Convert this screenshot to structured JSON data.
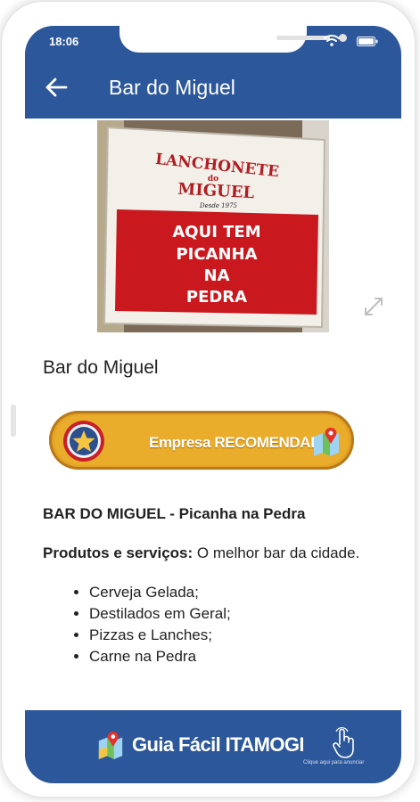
{
  "status_bar": {
    "time": "18:06"
  },
  "app_bar": {
    "title": "Bar do Miguel"
  },
  "photo": {
    "sign_top_line1": "LANCHONETE",
    "sign_top_line2": "do",
    "sign_top_line3": "MIGUEL",
    "sign_since": "Desde 1975",
    "sign_red_line1": "AQUI TEM",
    "sign_red_line2": "PICANHA",
    "sign_red_line3": "NA",
    "sign_red_line4": "PEDRA"
  },
  "business": {
    "name": "Bar do Miguel"
  },
  "badge": {
    "label": "Empresa RECOMENDADA"
  },
  "content": {
    "headline": "BAR DO MIGUEL - Picanha na Pedra",
    "desc_label": "Produtos e serviços:",
    "desc_text": " O melhor bar da cidade.",
    "items": [
      "Cerveja Gelada;",
      "Destilados em Geral;",
      "Pizzas e Lanches;",
      "Carne na Pedra"
    ]
  },
  "footer": {
    "brand": "Guia Fácil ITAMOGI",
    "cta_caption": "Clique aqui para anunciar"
  },
  "colors": {
    "primary": "#2c579a",
    "badge_gold": "#e9ac2b",
    "sign_red": "#c9191f"
  }
}
